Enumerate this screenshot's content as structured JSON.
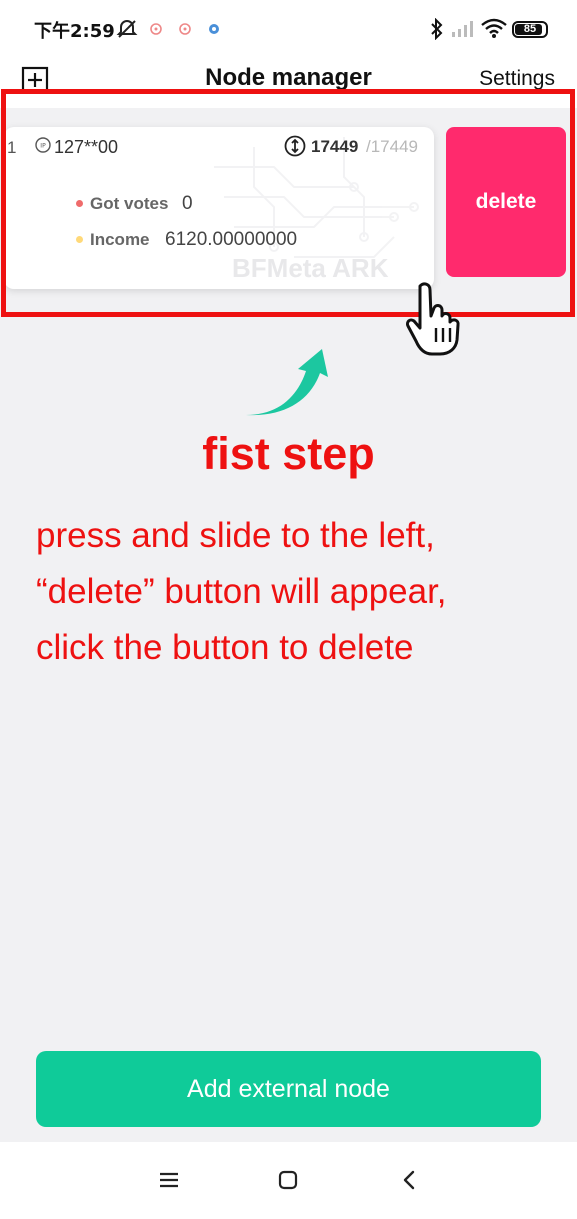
{
  "status_bar": {
    "time": "下午2:59",
    "battery": "85",
    "battery_level": 0.85
  },
  "header": {
    "title": "Node manager",
    "settings_label": "Settings",
    "add_icon": "plus-square-icon"
  },
  "node": {
    "index": "1",
    "ip_icon": "ip-icon",
    "ip": "127**00",
    "height_icon": "sync-height-icon",
    "height_current": "17449",
    "height_total": "/17449",
    "votes_label": "Got votes",
    "votes_value": "0",
    "income_label": "Income",
    "income_value": "6120.00000000",
    "watermark": "BFMeta ARK",
    "delete_label": "delete"
  },
  "annotation": {
    "title": "fist step",
    "line1": "press and slide to the left,",
    "line2": "“delete” button will appear,",
    "line3": "click the button to delete"
  },
  "footer": {
    "add_button_label": "Add external node"
  },
  "colors": {
    "accent_green": "#0fcb99",
    "delete_pink": "#ff2a6d",
    "annotation_red": "#ee1111",
    "votes_dot": "#ef6b6b",
    "income_dot": "#ffd979"
  }
}
